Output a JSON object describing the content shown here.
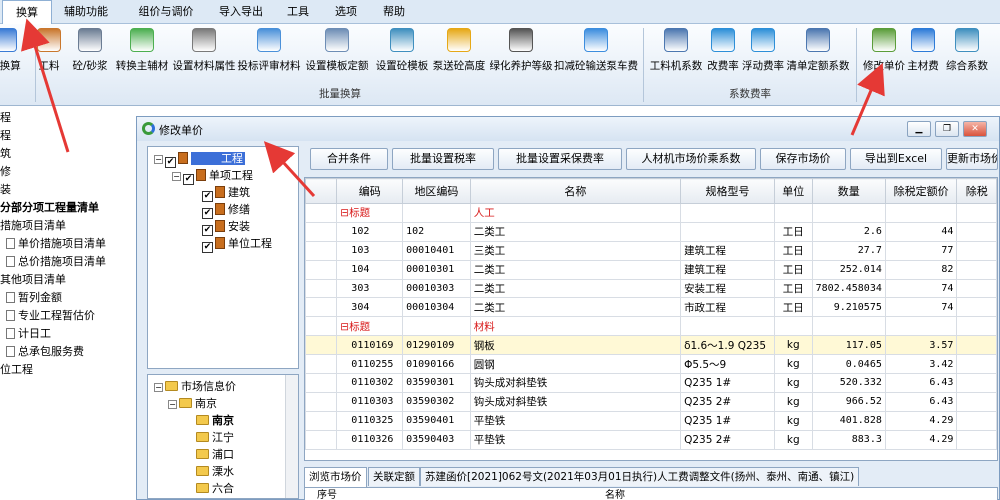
{
  "menu": [
    "换算",
    "辅助功能",
    "组价与调价",
    "导入导出",
    "工具",
    "选项",
    "帮助"
  ],
  "ribbon": {
    "buttons": [
      {
        "label": "砼换算",
        "icon": "convert-icon",
        "color": "#3a7bd5"
      },
      {
        "label": "工料",
        "icon": "brick-icon",
        "color": "#c9772d"
      },
      {
        "label": "砼/砂浆",
        "icon": "mixer-icon",
        "color": "#6b7c93"
      },
      {
        "label": "转换主辅材",
        "icon": "materials-icon",
        "color": "#4caf50"
      },
      {
        "label": "设置材料属性",
        "icon": "gears-icon",
        "color": "#7a7a7a"
      },
      {
        "label": "投标评审材料",
        "icon": "review-doc-icon",
        "color": "#4a90d9"
      },
      {
        "label": "设置模板定额",
        "icon": "template-icon",
        "color": "#6d8db5"
      },
      {
        "label": "设置砼模板",
        "icon": "grid-template-icon",
        "color": "#3f8fbf"
      },
      {
        "label": "泵送砼高度",
        "icon": "pump-truck-icon",
        "color": "#e6a817"
      },
      {
        "label": "绿化养护等级",
        "icon": "tree-icon",
        "color": "#555555"
      },
      {
        "label": "扣减砼输送泵车费",
        "icon": "lock-gear-icon",
        "color": "#3c8dde"
      },
      {
        "label": "工料机系数",
        "icon": "chart-icon",
        "color": "#4c77b0"
      },
      {
        "label": "改费率",
        "icon": "percent-icon",
        "color": "#2d8fd8"
      },
      {
        "label": "浮动费率",
        "icon": "percent-wave-icon",
        "color": "#2d8fd8"
      },
      {
        "label": "清单定额系数",
        "icon": "list-coef-icon",
        "color": "#4c77b0"
      },
      {
        "label": "修改单价",
        "icon": "edit-price-icon",
        "color": "#5b9d3a"
      },
      {
        "label": "主材费",
        "icon": "database-icon",
        "color": "#2d7bd8"
      },
      {
        "label": "综合系数",
        "icon": "table-icon",
        "color": "#3f8fbf"
      }
    ],
    "groups": {
      "batch": "批量换算",
      "coef": "系数费率"
    }
  },
  "bg_tree": {
    "rows": [
      "程",
      "程",
      "筑",
      "修",
      "装",
      "分部分项工程量清单",
      "措施项目清单",
      "单价措施项目清单",
      "总价措施项目清单",
      "其他项目清单",
      "暂列金额",
      "专业工程暂估价",
      "计日工",
      "总承包服务费",
      "位工程"
    ]
  },
  "dialog": {
    "title": "修改单价",
    "project_tree": {
      "root": "工程",
      "child": "单项工程",
      "leaves": [
        "建筑",
        "修缮",
        "安装",
        "单位工程"
      ]
    },
    "market_tree": {
      "root": "市场信息价",
      "region": "南京",
      "cities": [
        "南京",
        "江宁",
        "浦口",
        "溧水",
        "六合"
      ]
    },
    "toolbar": [
      "合并条件",
      "批量设置税率",
      "批量设置采保费率",
      "人材机市场价乘系数",
      "保存市场价",
      "导出到Excel",
      "更新市场价"
    ],
    "columns": [
      "编码",
      "地区编码",
      "名称",
      "规格型号",
      "单位",
      "数量",
      "除税定额价",
      "除税"
    ],
    "rows": [
      {
        "type": "header",
        "prefix": "⊟标题",
        "name": "人工"
      },
      {
        "code": "102",
        "region_code": "102",
        "name": "二类工",
        "spec": "",
        "unit": "工日",
        "qty": "2.6",
        "price": "44"
      },
      {
        "code": "103",
        "region_code": "00010401",
        "name": "三类工",
        "spec": "建筑工程",
        "unit": "工日",
        "qty": "27.7",
        "price": "77"
      },
      {
        "code": "104",
        "region_code": "00010301",
        "name": "二类工",
        "spec": "建筑工程",
        "unit": "工日",
        "qty": "252.014",
        "price": "82"
      },
      {
        "code": "303",
        "region_code": "00010303",
        "name": "二类工",
        "spec": "安装工程",
        "unit": "工日",
        "qty": "7802.458034",
        "price": "74"
      },
      {
        "code": "304",
        "region_code": "00010304",
        "name": "二类工",
        "spec": "市政工程",
        "unit": "工日",
        "qty": "9.210575",
        "price": "74"
      },
      {
        "type": "header",
        "prefix": "⊟标题",
        "name": "材料"
      },
      {
        "code": "0110169",
        "region_code": "01290109",
        "name": "钢板",
        "spec": "δ1.6～1.9 Q235",
        "unit": "kg",
        "qty": "117.05",
        "price": "3.57",
        "selected": true
      },
      {
        "code": "0110255",
        "region_code": "01090166",
        "name": "圆钢",
        "spec": "Φ5.5～9",
        "unit": "kg",
        "qty": "0.0465",
        "price": "3.42"
      },
      {
        "code": "0110302",
        "region_code": "03590301",
        "name": "钩头成对斜垫铁",
        "spec": "Q235 1#",
        "unit": "kg",
        "qty": "520.332",
        "price": "6.43"
      },
      {
        "code": "0110303",
        "region_code": "03590302",
        "name": "钩头成对斜垫铁",
        "spec": "Q235 2#",
        "unit": "kg",
        "qty": "966.52",
        "price": "6.43"
      },
      {
        "code": "0110325",
        "region_code": "03590401",
        "name": "平垫铁",
        "spec": "Q235 1#",
        "unit": "kg",
        "qty": "401.828",
        "price": "4.29"
      },
      {
        "code": "0110326",
        "region_code": "03590403",
        "name": "平垫铁",
        "spec": "Q235 2#",
        "unit": "kg",
        "qty": "883.3",
        "price": "4.29"
      }
    ],
    "tabs": [
      "浏览市场价",
      "关联定额",
      "苏建函价[2021]062号文(2021年03月01日执行)人工费调整文件(扬州、泰州、南通、镇江)"
    ],
    "bottom_header": [
      "序号",
      "名称"
    ]
  },
  "colors": {
    "accent": "#3a7bd5",
    "arrow": "#e53935",
    "header_red": "#d81a1a",
    "selected_row": "#fff9d6"
  }
}
